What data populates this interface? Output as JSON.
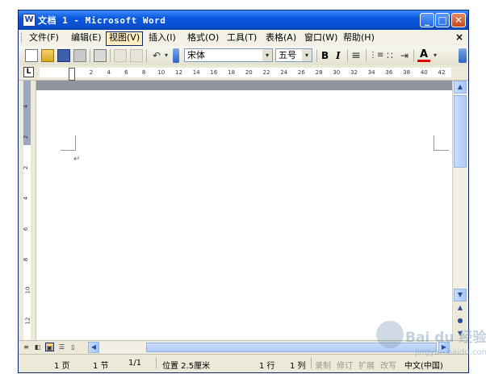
{
  "window": {
    "title": "文档 1 - Microsoft Word",
    "app_icon_letter": "W",
    "minimize_label": "_",
    "maximize_label": "□",
    "close_label": "✕"
  },
  "menu": {
    "items": [
      "文件(F)",
      "编辑(E)",
      "视图(V)",
      "插入(I)",
      "格式(O)",
      "工具(T)",
      "表格(A)",
      "窗口(W)",
      "帮助(H)"
    ],
    "active_index": 2,
    "close_label": "×"
  },
  "toolbar": {
    "undo_icon": "↶",
    "font_name": "宋体",
    "font_size": "五号",
    "bold_label": "B",
    "italic_label": "I",
    "align_icon": "≡",
    "numbering_icon": "⋮≡",
    "bullets_icon": "∷",
    "indent_icon": "⇥",
    "font_color_label": "A",
    "dropdown_arrow": "▾",
    "font_color_hex": "#e00000"
  },
  "ruler": {
    "tab_selector_label": "L",
    "ticks": [
      "2",
      "4",
      "6",
      "8",
      "10",
      "12",
      "14",
      "16",
      "18",
      "20",
      "22",
      "24",
      "26",
      "28",
      "30",
      "32",
      "34",
      "36",
      "38",
      "40",
      "42"
    ],
    "vertical_ticks": [
      "4",
      "2",
      "2",
      "4",
      "6",
      "8",
      "10",
      "12"
    ]
  },
  "document": {
    "paragraph_mark": "↵"
  },
  "scrollbar": {
    "up_arrow": "▲",
    "down_arrow": "▼",
    "prev_page": "▲",
    "select_browse": "●",
    "next_page": "▼",
    "left_arrow": "◀",
    "right_arrow": "▶"
  },
  "views": {
    "normal": "≡",
    "web": "◧",
    "print": "▣",
    "outline": "☰",
    "reading": "▯"
  },
  "status": {
    "page": "1 页",
    "section": "1 节",
    "page_of": "1/1",
    "position": "位置 2.5厘米",
    "line": "1 行",
    "column": "1 列",
    "rec": "录制",
    "trk": "修订",
    "ext": "扩展",
    "ovr": "改写",
    "language": "中文(中国)"
  },
  "watermark": {
    "brand": "Bai du 经验",
    "sub": "jingyan.baidu.com"
  }
}
